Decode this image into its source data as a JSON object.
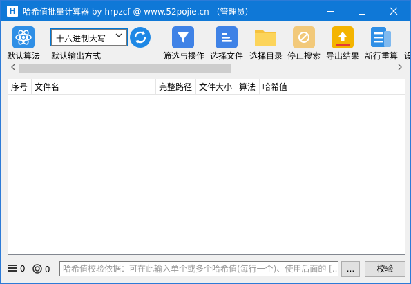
{
  "window": {
    "title": "哈希值批量计算器 by hrpzcf @ www.52pojie.cn （管理员）",
    "app_icon": "H",
    "accent_color": "#0f78d7"
  },
  "toolbar": {
    "default_algo_label": "默认算法",
    "output_combo_value": "十六进制大写",
    "output_label": "默认输出方式",
    "filter_label": "筛选与操作",
    "select_files_label": "选择文件",
    "select_dir_label": "选择目录",
    "stop_search_label": "停止搜索",
    "export_label": "导出结果",
    "new_calc_label": "新行重算",
    "more_label": "设"
  },
  "table": {
    "columns": [
      "序号",
      "文件名",
      "完整路径",
      "文件大小",
      "算法",
      "哈希值"
    ],
    "rows": []
  },
  "footer": {
    "list_count": "0",
    "target_count": "0",
    "verify_placeholder": "哈希值校验依据：可在此输入单个或多个哈希值(每行一个)、使用后面的 [...] 按钮导入文件...",
    "browse_label": "...",
    "verify_label": "校验"
  }
}
